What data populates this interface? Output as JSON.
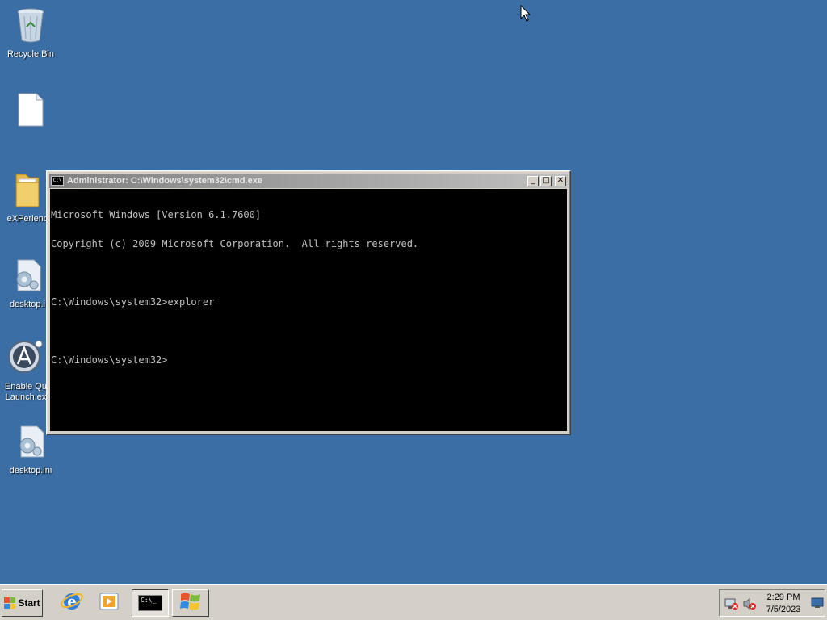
{
  "desktop": {
    "icons": [
      {
        "label": "Recycle Bin",
        "icon": "recycle-bin-icon"
      },
      {
        "label": "",
        "icon": "blank-document-icon"
      },
      {
        "label": "eXPerienc",
        "icon": "folder-icon"
      },
      {
        "label": "desktop.i",
        "icon": "config-file-icon"
      },
      {
        "label": "Enable Qu Launch.ex",
        "icon": "launcher-app-icon"
      },
      {
        "label": "desktop.ini",
        "icon": "config-file-icon"
      }
    ]
  },
  "cmd_window": {
    "title": "Administrator: C:\\Windows\\system32\\cmd.exe",
    "icon_text": "C:\\",
    "minimize_glyph": "_",
    "maximize_glyph": "□",
    "close_glyph": "✕",
    "lines": [
      "Microsoft Windows [Version 6.1.7600]",
      "Copyright (c) 2009 Microsoft Corporation.  All rights reserved.",
      "",
      "C:\\Windows\\system32>explorer",
      "",
      "C:\\Windows\\system32>"
    ]
  },
  "taskbar": {
    "start_label": "Start",
    "cmd_button_text": "C:\\_",
    "clock_time": "2:29 PM",
    "clock_date": "7/5/2023"
  },
  "colors": {
    "desktop_bg": "#3a6ea5",
    "console_bg": "#000000",
    "console_fg": "#c0c0c0"
  }
}
